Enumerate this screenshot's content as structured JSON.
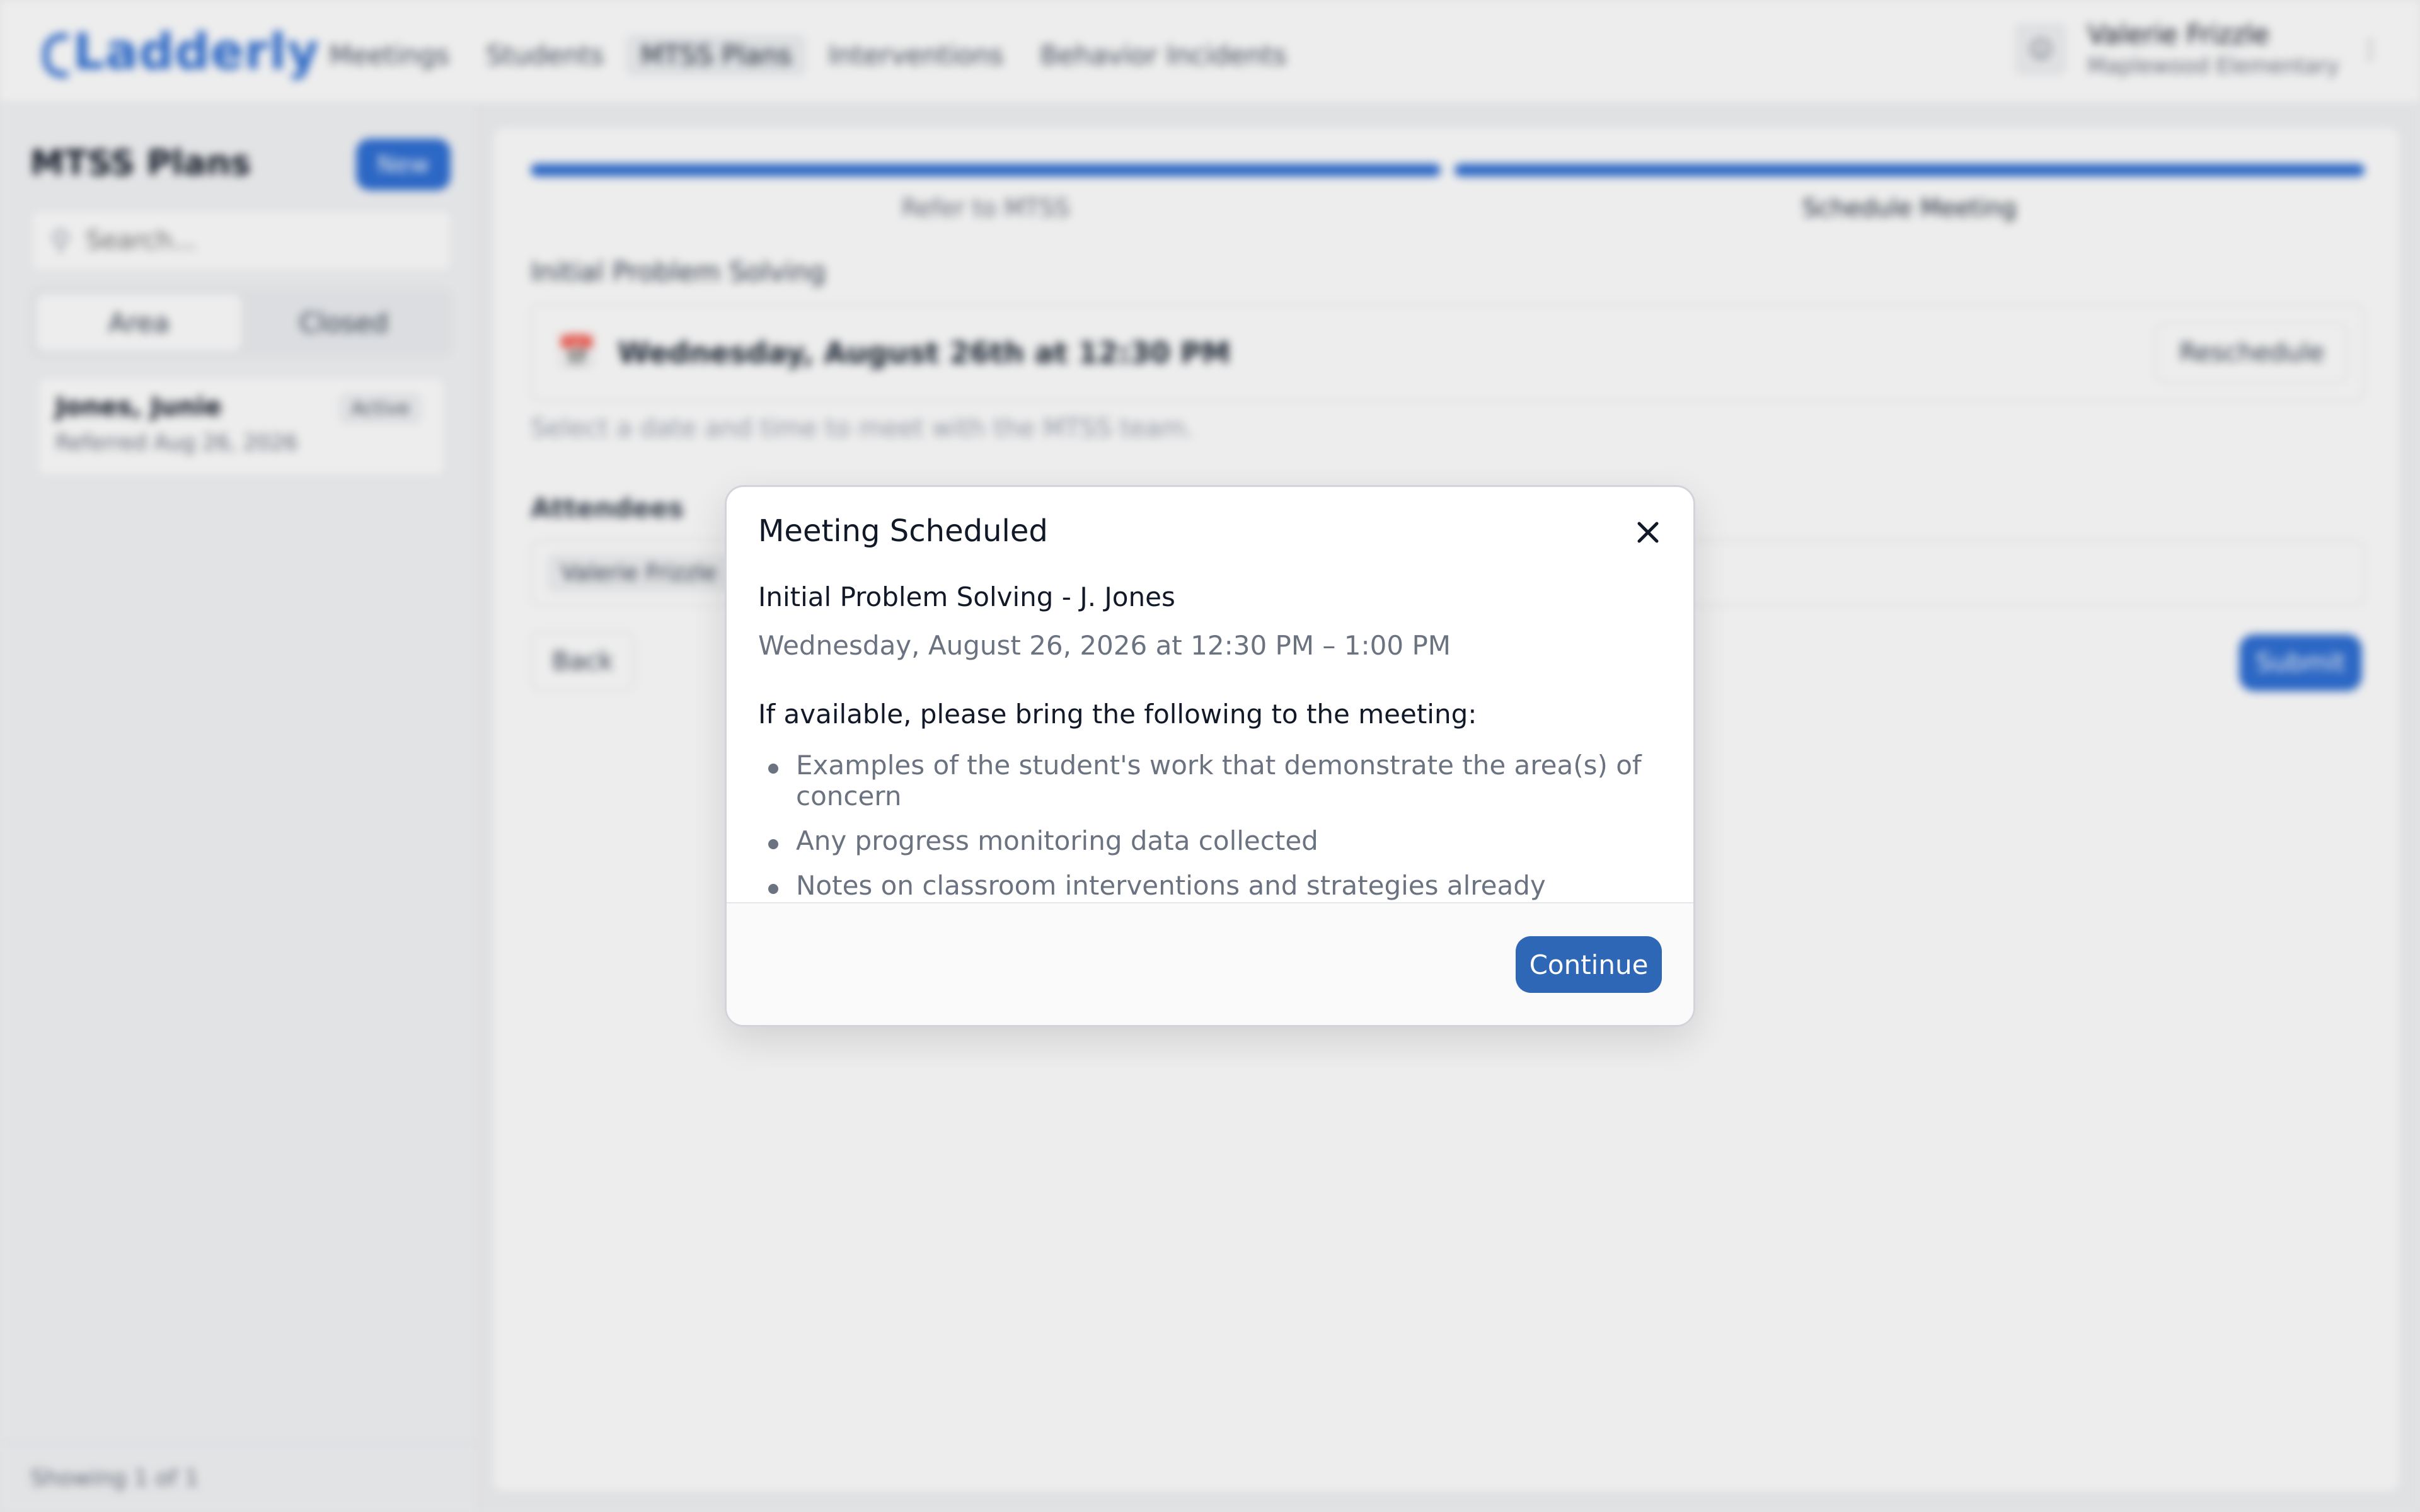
{
  "app": {
    "logo_text": "Ladderly",
    "nav": [
      {
        "label": "Meetings"
      },
      {
        "label": "Students"
      },
      {
        "label": "MTSS Plans",
        "active": true
      },
      {
        "label": "Interventions"
      },
      {
        "label": "Behavior Incidents"
      }
    ],
    "user": {
      "name": "Valerie Frizzle",
      "school": "Maplewood Elementary"
    }
  },
  "sidebar": {
    "title": "MTSS Plans",
    "new_label": "New",
    "search_placeholder": "Search...",
    "tabs": [
      {
        "label": "Area",
        "active": true
      },
      {
        "label": "Closed"
      }
    ],
    "card": {
      "name": "Jones, Junie",
      "date": "Referred Aug 26, 2026",
      "badge": "Active"
    },
    "footer": "Showing 1 of 1"
  },
  "main": {
    "steps": [
      {
        "label": "Refer to MTSS"
      },
      {
        "label": "Schedule Meeting",
        "current": true
      }
    ],
    "section_title": "Initial Problem Solving",
    "date_text": "Wednesday, August 26th at 12:30 PM",
    "reschedule_label": "Reschedule",
    "hint": "Select a date and time to meet with the MTSS team.",
    "attendees_title": "Attendees",
    "attendee_chip": "Valerie Frizzle",
    "back_label": "Back",
    "submit_label": "Submit"
  },
  "modal": {
    "title": "Meeting Scheduled",
    "meeting_title": "Initial Problem Solving - J. Jones",
    "meeting_time": "Wednesday, August 26, 2026 at 12:30 PM – 1:00 PM",
    "bring_label": "If available, please bring the following to the meeting:",
    "bring_items": [
      "Examples of the student's work that demonstrate the area(s) of concern",
      "Any progress monitoring data collected",
      "Notes on classroom interventions and strategies already attempted"
    ],
    "continue_label": "Continue"
  },
  "colors": {
    "accent": "#2d67b6",
    "accent_light": "#2f6fd4"
  }
}
